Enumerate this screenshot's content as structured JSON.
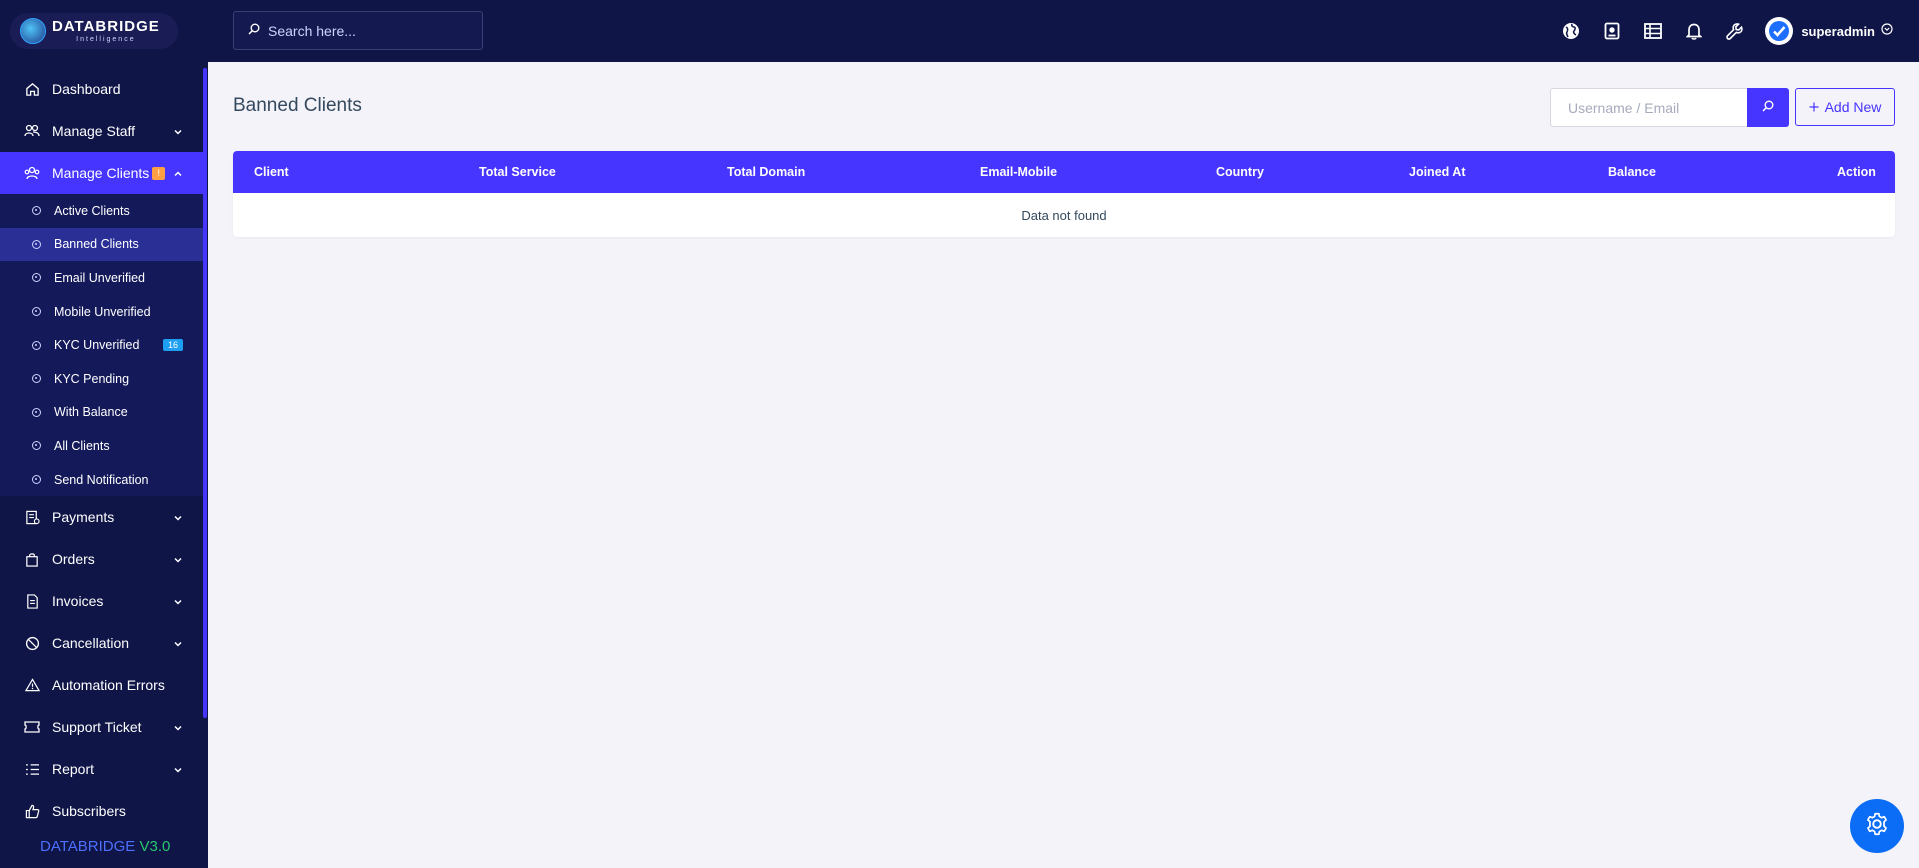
{
  "brand": {
    "logo_main": "DATABRIDGE",
    "logo_sub": "Intelligence",
    "version_name": "DATABRIDGE",
    "version_num": "V3.0"
  },
  "colors": {
    "sidebar": "#0f1547",
    "accent": "#4634ff",
    "warning": "#ff9f43",
    "info": "#1e9ff2",
    "success": "#28c76f"
  },
  "search": {
    "placeholder": "Search here..."
  },
  "header": {
    "username": "superadmin",
    "icons": [
      "globe-icon",
      "portfolio-icon",
      "list-icon",
      "bell-icon",
      "wrench-icon"
    ]
  },
  "sidebar": {
    "dashboard": "Dashboard",
    "manage_staff": "Manage Staff",
    "manage_clients": "Manage Clients",
    "manage_clients_badge": "!",
    "sub": {
      "active": "Active Clients",
      "banned": "Banned Clients",
      "email_unverified": "Email Unverified",
      "mobile_unverified": "Mobile Unverified",
      "kyc_unverified": "KYC Unverified",
      "kyc_unverified_count": "16",
      "kyc_pending": "KYC Pending",
      "with_balance": "With Balance",
      "all": "All Clients",
      "send_notification": "Send Notification"
    },
    "payments": "Payments",
    "orders": "Orders",
    "invoices": "Invoices",
    "cancellation": "Cancellation",
    "automation_errors": "Automation Errors",
    "support_ticket": "Support Ticket",
    "report": "Report",
    "subscribers": "Subscribers"
  },
  "main": {
    "title": "Banned Clients",
    "filter_placeholder": "Username / Email",
    "add_new": "Add New",
    "table": {
      "columns": {
        "client": "Client",
        "total_service": "Total Service",
        "total_domain": "Total Domain",
        "email_mobile": "Email-Mobile",
        "country": "Country",
        "joined_at": "Joined At",
        "balance": "Balance",
        "action": "Action"
      },
      "empty": "Data not found"
    }
  }
}
